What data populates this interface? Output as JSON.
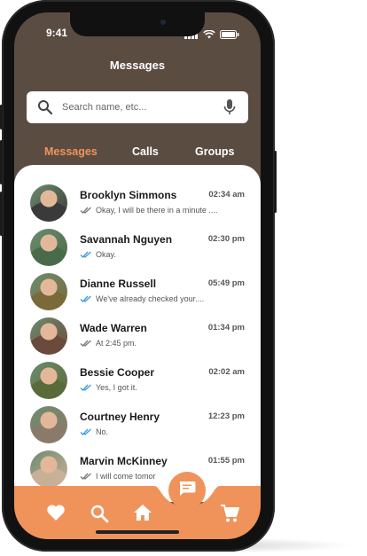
{
  "status_bar": {
    "time": "9:41"
  },
  "header": {
    "title": "Messages"
  },
  "search": {
    "placeholder": "Search name, etc..."
  },
  "tabs": [
    {
      "label": "Messages",
      "active": true
    },
    {
      "label": "Calls",
      "active": false
    },
    {
      "label": "Groups",
      "active": false
    }
  ],
  "conversations": [
    {
      "name": "Brooklyn Simmons",
      "time": "02:34 am",
      "preview": "Okay, I will be there in a minute ....",
      "read": false,
      "avatar_color": "#3a3a3a"
    },
    {
      "name": "Savannah Nguyen",
      "time": "02:30 pm",
      "preview": "Okay.",
      "read": true,
      "avatar_color": "#4a6b4a"
    },
    {
      "name": "Dianne Russell",
      "time": "05:49 pm",
      "preview": "We've already checked your....",
      "read": true,
      "avatar_color": "#7a6a3a"
    },
    {
      "name": "Wade Warren",
      "time": "01:34 pm",
      "preview": "At 2:45 pm.",
      "read": false,
      "avatar_color": "#6a4a3a"
    },
    {
      "name": "Bessie Cooper",
      "time": "02:02 am",
      "preview": "Yes, I got it.",
      "read": true,
      "avatar_color": "#5a6a3a"
    },
    {
      "name": "Courtney Henry",
      "time": "12:23 pm",
      "preview": "No.",
      "read": true,
      "avatar_color": "#8a7a6a"
    },
    {
      "name": "Marvin McKinney",
      "time": "01:55 pm",
      "preview": "I will come tomor",
      "read": false,
      "avatar_color": "#c8b098"
    }
  ],
  "bottom_nav": [
    "heart-icon",
    "search-icon",
    "home-icon",
    "chat-icon",
    "cart-icon"
  ],
  "colors": {
    "brown": "#5b4c42",
    "accent": "#f0935b",
    "read_tick": "#3b9be0",
    "unread_tick": "#777777"
  }
}
